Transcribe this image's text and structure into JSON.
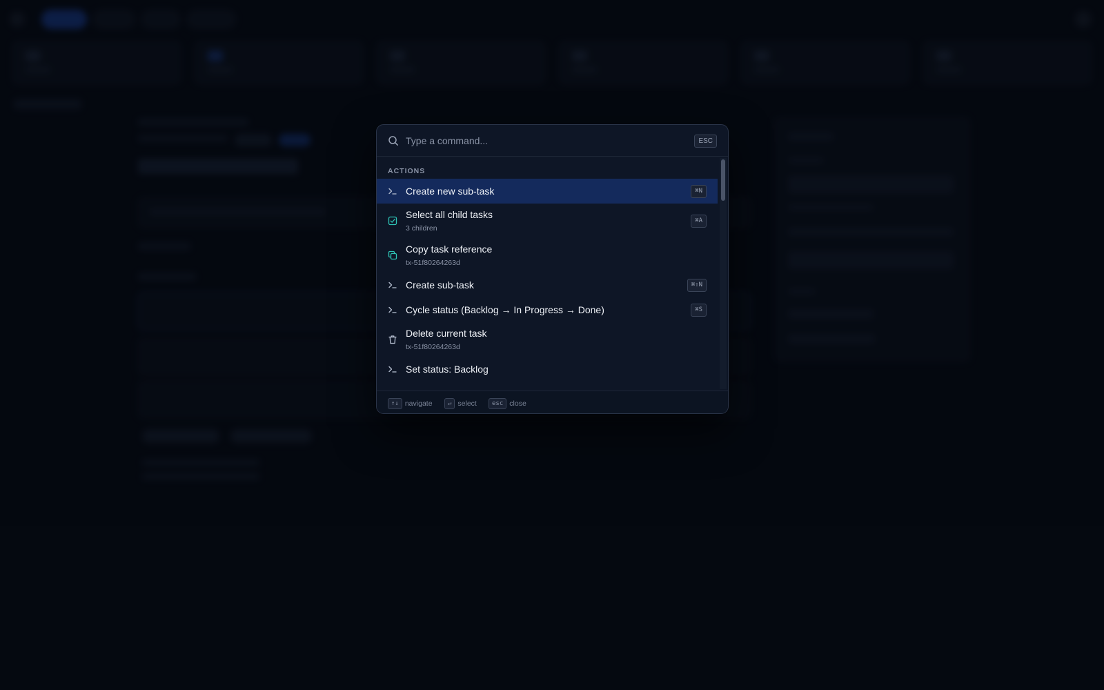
{
  "palette": {
    "search": {
      "placeholder": "Type a command...",
      "value": "",
      "esc_key": "ESC"
    },
    "section_title": "ACTIONS",
    "items": [
      {
        "label": "Create new sub-task",
        "subtitle": "",
        "shortcut": "⌘N",
        "icon": "terminal-icon",
        "selected": true
      },
      {
        "label": "Select all child tasks",
        "subtitle": "3 children",
        "shortcut": "⌘A",
        "icon": "checkbox-icon",
        "selected": false
      },
      {
        "label": "Copy task reference",
        "subtitle": "tx-51f80264263d",
        "shortcut": "",
        "icon": "copy-icon",
        "selected": false
      },
      {
        "label": "Create sub-task",
        "subtitle": "",
        "shortcut": "⌘⇧N",
        "icon": "terminal-icon",
        "selected": false
      },
      {
        "label": "Cycle status (Backlog → In Progress → Done)",
        "subtitle": "",
        "shortcut": "⌘S",
        "icon": "terminal-icon",
        "selected": false
      },
      {
        "label": "Delete current task",
        "subtitle": "tx-51f80264263d",
        "shortcut": "",
        "icon": "trash-icon",
        "selected": false
      },
      {
        "label": "Set status: Backlog",
        "subtitle": "",
        "shortcut": "",
        "icon": "terminal-icon",
        "selected": false
      }
    ],
    "footer": {
      "navigate": {
        "key": "↑↓",
        "label": "navigate"
      },
      "select": {
        "key": "↵",
        "label": "select"
      },
      "close": {
        "key": "esc",
        "label": "close"
      }
    }
  },
  "colors": {
    "background": "#060a12",
    "palette_bg": "#0e1626",
    "selected_row": "#142a5c",
    "accent_teal": "#2ec4b6",
    "muted_text": "#8a93a6"
  }
}
